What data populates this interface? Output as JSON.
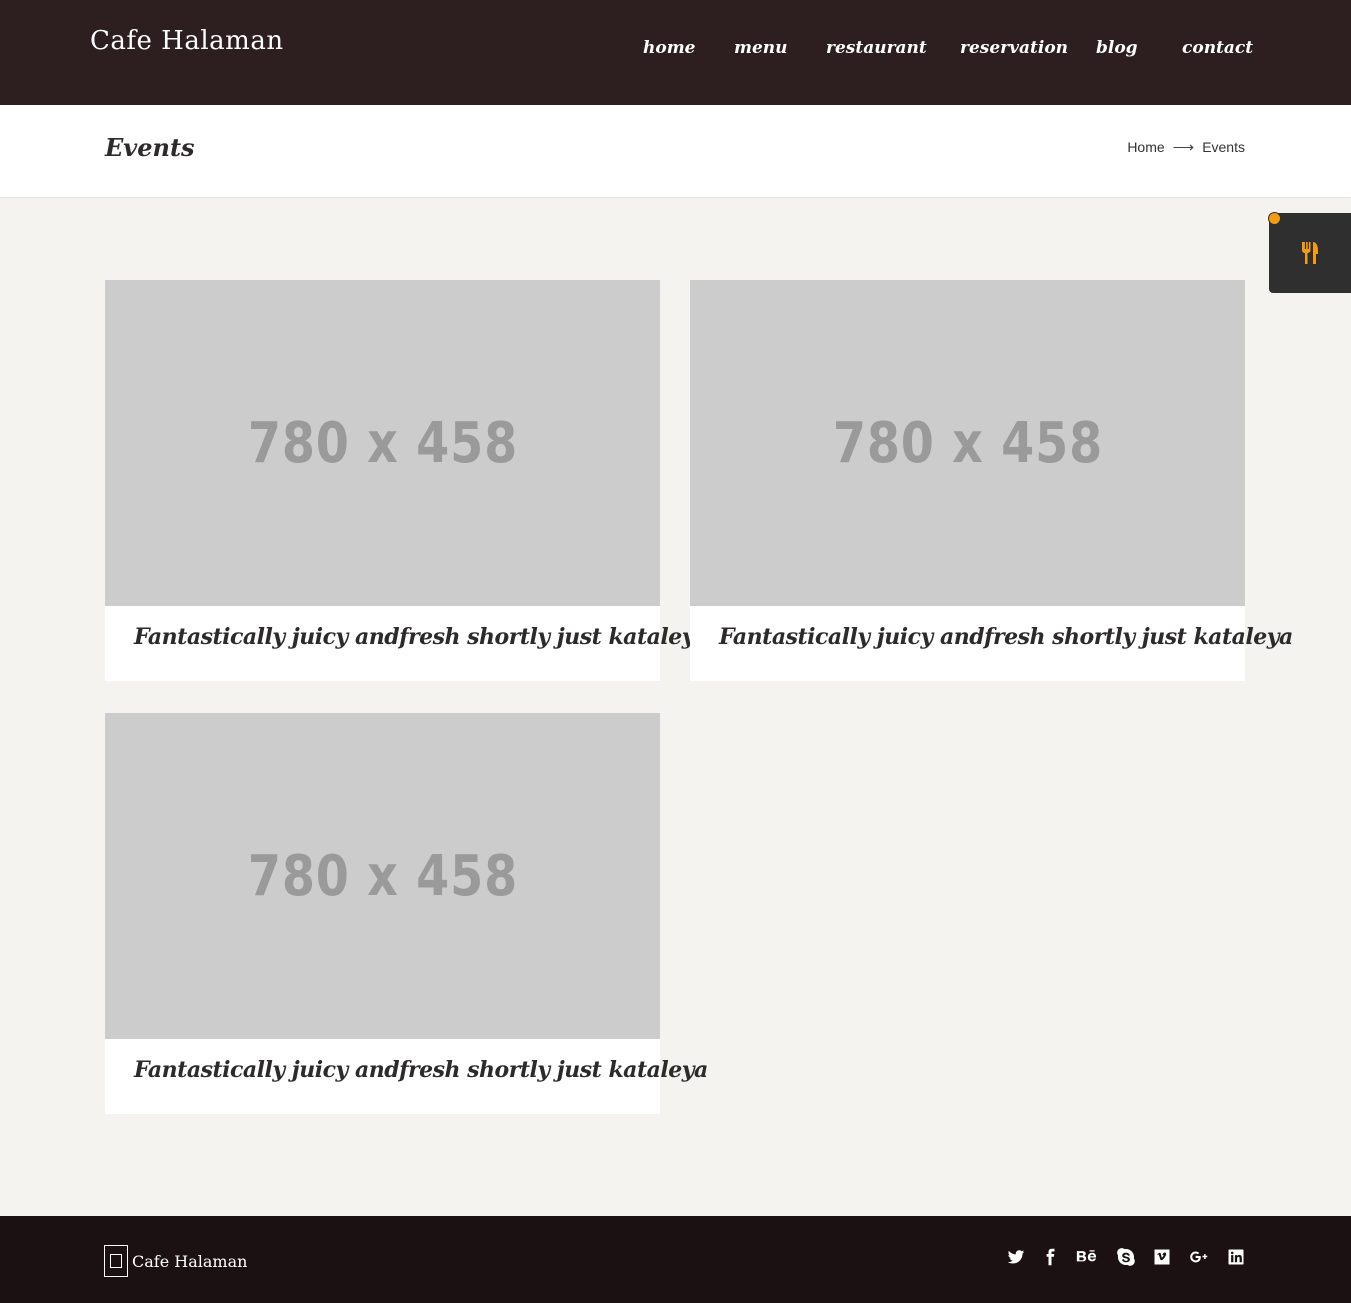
{
  "header": {
    "logo": "Cafe Halaman",
    "nav": [
      "home",
      "menu",
      "restaurant",
      "reservation",
      "blog",
      "contact"
    ]
  },
  "titlebar": {
    "title": "Events",
    "breadcrumb": {
      "home": "Home",
      "arrow": "⟶",
      "current": "Events"
    }
  },
  "side_widget": {
    "icon": "fork-knife-icon",
    "accent": "#f39c12"
  },
  "events": [
    {
      "image_text": "780 x 458",
      "caption": "Fantastically juicy andfresh shortly just kataleya"
    },
    {
      "image_text": "780 x 458",
      "caption": "Fantastically juicy andfresh shortly just kataleya"
    },
    {
      "image_text": "780 x 458",
      "caption": "Fantastically juicy andfresh shortly just kataleya"
    }
  ],
  "footer": {
    "logo": "Cafe Halaman",
    "social": [
      "twitter-icon",
      "facebook-icon",
      "behance-icon",
      "skype-icon",
      "vimeo-icon",
      "google-plus-icon",
      "linkedin-icon"
    ]
  },
  "colors": {
    "header_bg": "#2d1e1f",
    "footer_bg": "#1b1112",
    "page_bg": "#f4f3f0",
    "placeholder_bg": "#cccccc"
  }
}
